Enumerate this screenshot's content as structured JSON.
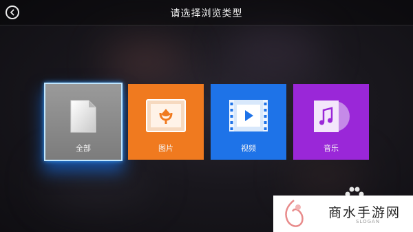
{
  "header": {
    "title": "请选择浏览类型"
  },
  "tiles": [
    {
      "label": "全部",
      "icon": "document-icon",
      "color": "#8f8f8f",
      "selected": true
    },
    {
      "label": "图片",
      "icon": "picture-icon",
      "color": "#f07a1f",
      "selected": false
    },
    {
      "label": "视频",
      "icon": "video-icon",
      "color": "#1e73e8",
      "selected": false
    },
    {
      "label": "音乐",
      "icon": "music-icon",
      "color": "#9a27d8",
      "selected": false
    }
  ],
  "watermark": {
    "text": "商水手游网",
    "sub": "SLOGAN"
  },
  "colors": {
    "focus": "#3ca0ff",
    "header_bg": "#000000"
  }
}
